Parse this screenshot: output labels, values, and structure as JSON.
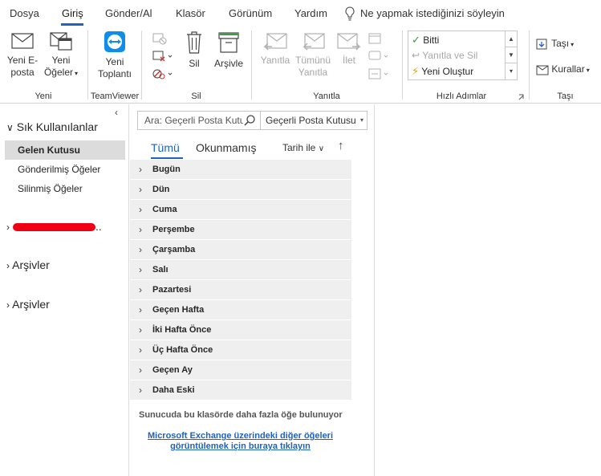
{
  "menubar": {
    "tabs": [
      "Dosya",
      "Giriş",
      "Gönder/Al",
      "Klasör",
      "Görünüm",
      "Yardım"
    ],
    "active": "Giriş",
    "tell_me": "Ne yapmak istediğinizi söyleyin"
  },
  "ribbon": {
    "groups": {
      "new": "Yeni",
      "teamviewer": "TeamViewer",
      "delete": "Sil",
      "respond": "Yanıtla",
      "quick_steps": "Hızlı Adımlar",
      "move": "Taşı"
    },
    "buttons": {
      "new_email_1": "Yeni E-",
      "new_email_2": "posta",
      "new_items_1": "Yeni",
      "new_items_2": "Öğeler",
      "new_meeting_1": "Yeni",
      "new_meeting_2": "Toplantı",
      "delete": "Sil",
      "archive": "Arşivle",
      "reply": "Yanıtla",
      "reply_all_1": "Tümünü",
      "reply_all_2": "Yanıtla",
      "forward": "İlet",
      "move": "Taşı",
      "rules": "Kurallar"
    },
    "quick_steps": [
      "Bitti",
      "Yanıtla ve Sil",
      "Yeni Oluştur"
    ]
  },
  "nav": {
    "favorites_header": "Sık Kullanılanlar",
    "favorites": [
      "Gelen Kutusu",
      "Gönderilmiş Öğeler",
      "Silinmiş Öğeler"
    ],
    "selected": "Gelen Kutusu",
    "account_suffix": "..",
    "archives_1": "Arşivler",
    "archives_2": "Arşivler"
  },
  "list": {
    "search_placeholder": "Ara: Geçerli Posta Kutusu",
    "scope": "Geçerli Posta Kutusu",
    "filter_all": "Tümü",
    "filter_unread": "Okunmamış",
    "sort_by": "Tarih ile",
    "groups": [
      "Bugün",
      "Dün",
      "Cuma",
      "Perşembe",
      "Çarşamba",
      "Salı",
      "Pazartesi",
      "Geçen Hafta",
      "İki Hafta Önce",
      "Üç Hafta Önce",
      "Geçen Ay",
      "Daha Eski"
    ],
    "server_note": "Sunucuda bu klasörde daha fazla öğe bulunuyor",
    "exchange_link_1": "Microsoft Exchange üzerindeki diğer öğeleri",
    "exchange_link_2": "görüntülemek için buraya tıklayın"
  },
  "colors": {
    "accent": "#1e62c2",
    "teamviewer": "#0e8ee9",
    "redaction": "#f00014"
  }
}
